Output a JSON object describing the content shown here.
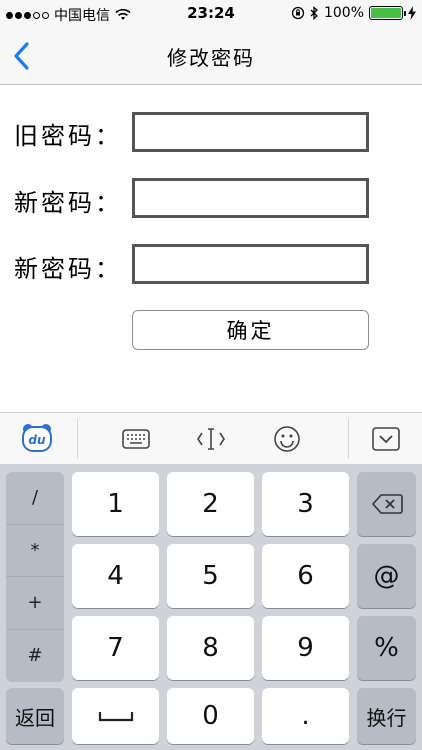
{
  "status_bar": {
    "carrier": "中国电信",
    "time": "23:24",
    "battery": "100%"
  },
  "nav": {
    "title": "修改密码"
  },
  "form": {
    "old_password_label": "旧密码：",
    "new_password_label": "新密码：",
    "confirm_password_label": "新密码：",
    "old_password_value": "",
    "new_password_value": "",
    "confirm_password_value": "",
    "confirm_button": "确定"
  },
  "keyboard": {
    "symbols": [
      "/",
      "*",
      "+",
      "#"
    ],
    "back_label": "返回",
    "digits": [
      "1",
      "2",
      "3",
      "4",
      "5",
      "6",
      "7",
      "8",
      "9",
      "0"
    ],
    "at": "@",
    "percent": "%",
    "dot": ".",
    "newline_label": "换行",
    "toolbar_logo": "du"
  },
  "colors": {
    "accent": "#1a7cf5",
    "battery": "#46c044",
    "keyboard_bg": "#cfd3d9",
    "function_key": "#b6bcc6"
  }
}
